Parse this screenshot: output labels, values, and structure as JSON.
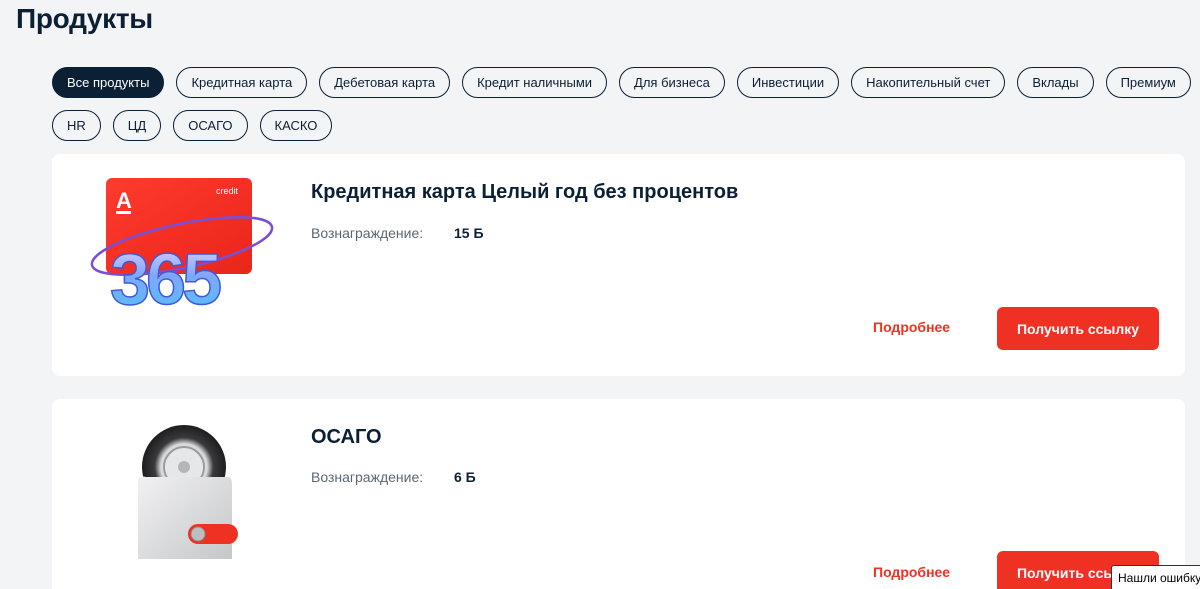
{
  "page": {
    "title": "Продукты"
  },
  "filters": {
    "row1": [
      "Все продукты",
      "Кредитная карта",
      "Дебетовая карта",
      "Кредит наличными",
      "Для бизнеса",
      "Инвестиции",
      "Накопительный счет",
      "Вклады",
      "Премиум"
    ],
    "row2": [
      "HR",
      "ЦД",
      "ОСАГО",
      "КАСКО"
    ],
    "active": "Все продукты"
  },
  "cards": [
    {
      "title": "Кредитная карта Целый год без процентов",
      "reward_label": "Вознаграждение:",
      "reward_value": "15 Б",
      "more_label": "Подробнее",
      "cta_label": "Получить ссылку",
      "image": {
        "icon": "credit-card-365-image",
        "card_text": "credit",
        "logo_letter": "А",
        "big_number": "365"
      }
    },
    {
      "title": "ОСАГО",
      "reward_label": "Вознаграждение:",
      "reward_value": "6 Б",
      "more_label": "Подробнее",
      "cta_label": "Получить ссылку",
      "image": {
        "icon": "wheel-in-pocket-image"
      }
    }
  ],
  "error_tooltip": {
    "label": "Нашли ошибку?"
  },
  "colors": {
    "accent": "#ef3124",
    "text": "#0b1f35",
    "background": "#f3f4f5"
  }
}
